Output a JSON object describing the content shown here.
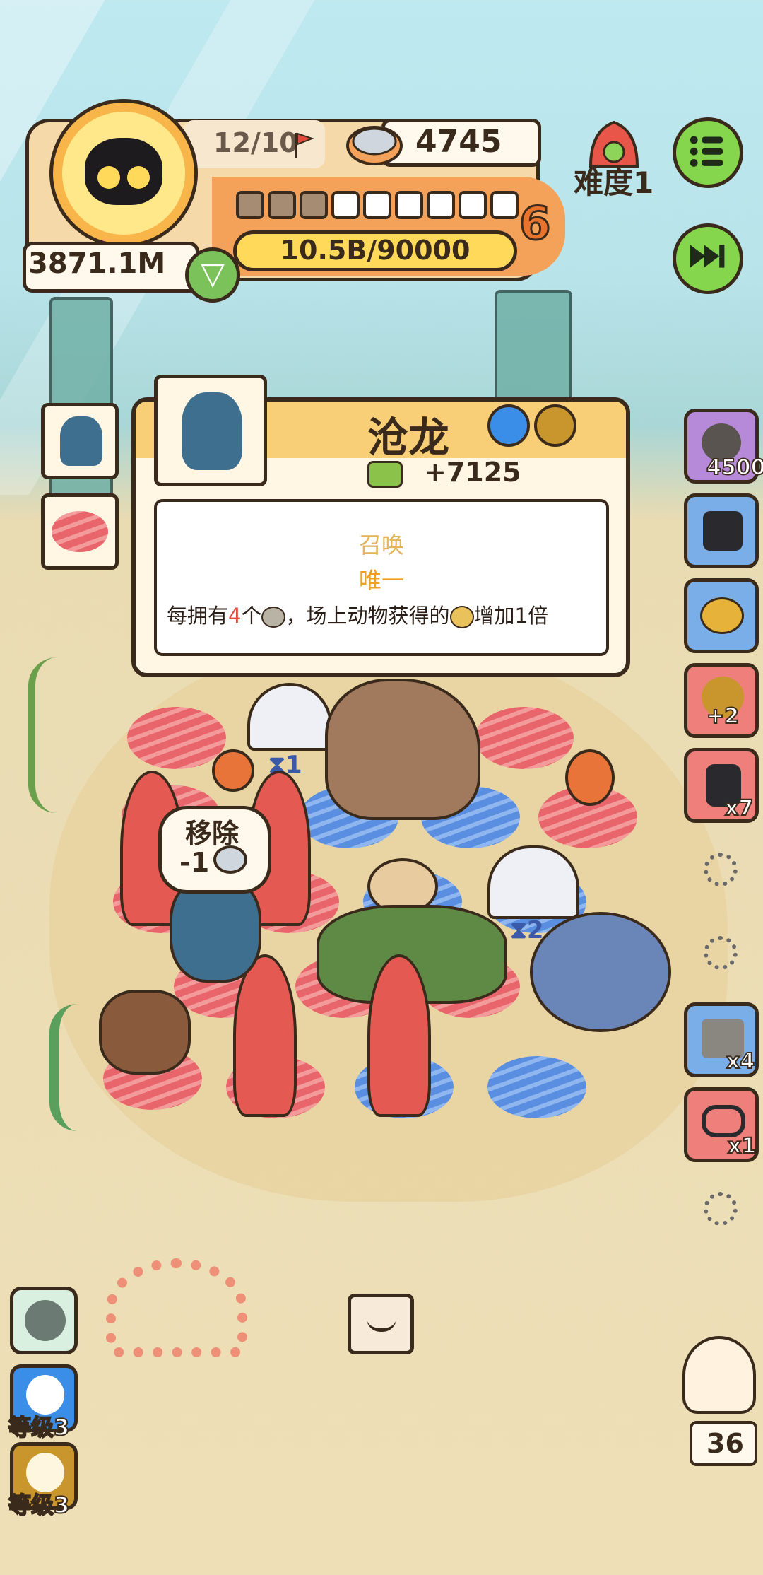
{
  "hud": {
    "wave": "12/10",
    "cans": "4745",
    "money": "3871.1M",
    "level": "6",
    "xp": "10.5B/90000",
    "pips": {
      "filled": 3,
      "total": 9
    }
  },
  "difficulty": {
    "label": "难度1"
  },
  "card": {
    "name": "沧龙",
    "profit": "+7125",
    "tag1": "召唤",
    "tag2": "唯一",
    "desc_a": "每拥有",
    "desc_num": "4",
    "desc_b": "个",
    "desc_c": "，场上动物获得的",
    "desc_d": "增加1倍"
  },
  "board": {
    "remove_label": "移除",
    "remove_cost": "-1",
    "timer1": "1",
    "timer2": "2"
  },
  "right_items": [
    {
      "label": "4500"
    },
    {
      "label": ""
    },
    {
      "label": ""
    },
    {
      "label": "+2"
    },
    {
      "label": "x7"
    },
    {
      "label": "x4"
    },
    {
      "label": "x1"
    }
  ],
  "bottom_left": [
    {
      "label": ""
    },
    {
      "label": "等级3"
    },
    {
      "label": "等级3"
    }
  ],
  "pet_counter": "36",
  "colors": {
    "accent_orange": "#f4a15a",
    "button_green": "#86d64d",
    "meat_tile": "#e9656c",
    "water_tile": "#5a8ee0"
  }
}
